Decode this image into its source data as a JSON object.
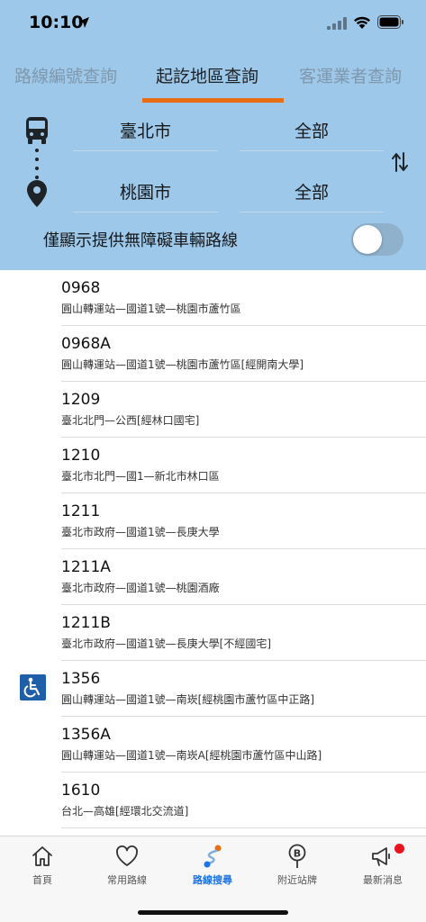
{
  "status_bar": {
    "time": "10:10"
  },
  "tabs": [
    {
      "label": "路線編號查詢",
      "active": false
    },
    {
      "label": "起訖地區查詢",
      "active": true
    },
    {
      "label": "客運業者查詢",
      "active": false
    }
  ],
  "filter": {
    "from_city": "臺北市",
    "from_area": "全部",
    "to_city": "桃園市",
    "to_area": "全部",
    "accessible_only_label": "僅顯示提供無障礙車輛路線",
    "accessible_only_enabled": false
  },
  "routes": [
    {
      "number": "0968",
      "description": "圓山轉運站—國道1號—桃園市蘆竹區",
      "accessible": false
    },
    {
      "number": "0968A",
      "description": "圓山轉運站—國道1號—桃園市蘆竹區[經開南大學]",
      "accessible": false
    },
    {
      "number": "1209",
      "description": "臺北北門—公西[經林口國宅]",
      "accessible": false
    },
    {
      "number": "1210",
      "description": "臺北市北門—國1—新北市林口區",
      "accessible": false
    },
    {
      "number": "1211",
      "description": "臺北市政府—國道1號—長庚大學",
      "accessible": false
    },
    {
      "number": "1211A",
      "description": "臺北市政府—國道1號—桃園酒廠",
      "accessible": false
    },
    {
      "number": "1211B",
      "description": "臺北市政府—國道1號—長庚大學[不經國宅]",
      "accessible": false
    },
    {
      "number": "1356",
      "description": "圓山轉運站—國道1號—南崁[經桃園市蘆竹區中正路]",
      "accessible": true
    },
    {
      "number": "1356A",
      "description": "圓山轉運站—國道1號—南崁A[經桃園市蘆竹區中山路]",
      "accessible": false
    },
    {
      "number": "1610",
      "description": "台北—高雄[經環北交流道]",
      "accessible": false
    }
  ],
  "bottom_nav": [
    {
      "label": "首頁",
      "icon": "home-icon",
      "active": false
    },
    {
      "label": "常用路線",
      "icon": "heart-icon",
      "active": false
    },
    {
      "label": "路線搜尋",
      "icon": "route-search-icon",
      "active": true
    },
    {
      "label": "附近站牌",
      "icon": "bus-stop-icon",
      "active": false
    },
    {
      "label": "最新消息",
      "icon": "megaphone-icon",
      "active": false,
      "has_badge": true
    }
  ],
  "colors": {
    "header_bg": "#9ec8ea",
    "tab_indicator": "#e96e13",
    "active_nav": "#1b73e8",
    "accessible_badge": "#1f5ea8",
    "notification_dot": "#e8141e"
  }
}
